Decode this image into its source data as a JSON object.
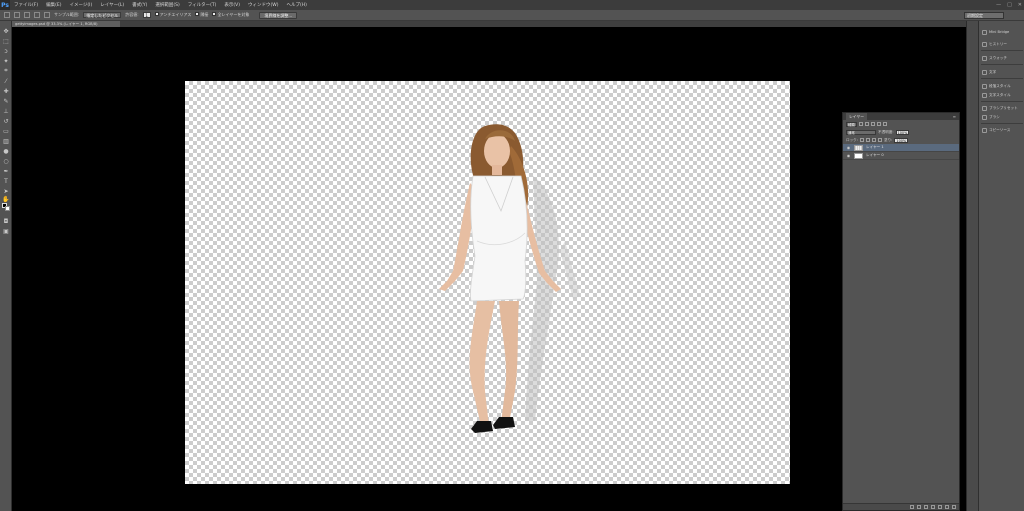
{
  "app": {
    "logo_text": "Ps",
    "window_controls": [
      "—",
      "□",
      "✕"
    ]
  },
  "menubar": {
    "items": [
      "ファイル(F)",
      "編集(E)",
      "イメージ(I)",
      "レイヤー(L)",
      "書式(Y)",
      "選択範囲(S)",
      "フィルター(T)",
      "表示(V)",
      "ウィンドウ(W)",
      "ヘルプ(H)"
    ]
  },
  "options": {
    "sample_size_label": "サンプル範囲:",
    "sample_size_value": "指定したピクセル",
    "tolerance_label": "許容値:",
    "tolerance_value": "1",
    "antialias_label": "アンチエイリアス",
    "contiguous_label": "隣接",
    "all_layers_label": "全レイヤーを対象",
    "refine_edge_button": "境界線を調整...",
    "workspace": "初期設定"
  },
  "document_tab": {
    "title": "gettyimages.psd @ 33.3% (レイヤー 1, RGB/8)"
  },
  "layers": {
    "tab_label": "レイヤー",
    "menu_icon": "≡",
    "kind_label": "種類",
    "blend_mode": "通常",
    "opacity_label": "不透明度:",
    "opacity_value": "100%",
    "lock_label": "ロック:",
    "fill_label": "塗り:",
    "fill_value": "100%",
    "items": [
      {
        "name": "レイヤー 1",
        "selected": true,
        "thumb": "checker"
      },
      {
        "name": "レイヤー 0",
        "selected": false,
        "thumb": "white"
      }
    ]
  },
  "right_panel": {
    "items": [
      {
        "icon": "mini-bridge-icon",
        "label": "Mini Bridge"
      },
      {
        "icon": "history-icon",
        "label": "ヒストリー"
      },
      {
        "icon": "swatches-icon",
        "label": "スウォッチ"
      },
      {
        "icon": "character-icon",
        "label": "文字"
      },
      {
        "icon": "paragraph-style-icon",
        "label": "段落スタイル"
      },
      {
        "icon": "char-style-icon",
        "label": "文字スタイル"
      },
      {
        "icon": "brush-preset-icon",
        "label": "ブラシプリセット"
      },
      {
        "icon": "brush-icon",
        "label": "ブラシ"
      },
      {
        "icon": "clone-source-icon",
        "label": "コピーソース"
      }
    ]
  }
}
